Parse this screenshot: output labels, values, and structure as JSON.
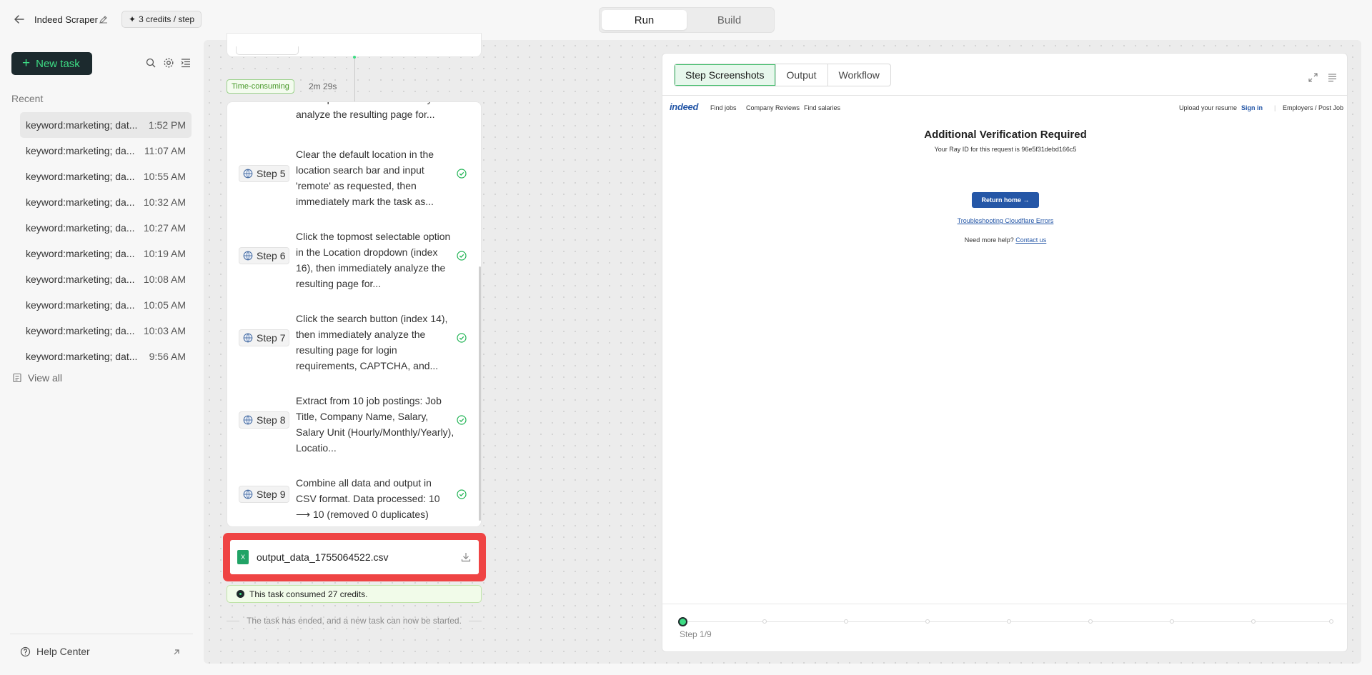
{
  "header": {
    "app_title": "Indeed Scraper",
    "credits_per_step": "3 credits / step",
    "mode_run": "Run",
    "mode_build": "Build"
  },
  "sidebar": {
    "new_task": "New task",
    "recent_heading": "Recent",
    "recent": [
      {
        "name": "keyword:marketing; dat...",
        "time": "1:52 PM"
      },
      {
        "name": "keyword:marketing; da...",
        "time": "11:07 AM"
      },
      {
        "name": "keyword:marketing; da...",
        "time": "10:55 AM"
      },
      {
        "name": "keyword:marketing; da...",
        "time": "10:32 AM"
      },
      {
        "name": "keyword:marketing; da...",
        "time": "10:27 AM"
      },
      {
        "name": "keyword:marketing; da...",
        "time": "10:19 AM"
      },
      {
        "name": "keyword:marketing; da...",
        "time": "10:08 AM"
      },
      {
        "name": "keyword:marketing; da...",
        "time": "10:05 AM"
      },
      {
        "name": "keyword:marketing; da...",
        "time": "10:03 AM"
      },
      {
        "name": "keyword:marketing; dat...",
        "time": "9:56 AM"
      }
    ],
    "view_all": "View all",
    "help_center": "Help Center"
  },
  "workflow": {
    "badge": "Time-consuming",
    "duration": "2m 29s",
    "partial_text": "the dropdown and immediately analyze the resulting page for...",
    "steps": [
      {
        "label": "Step 5",
        "text": "Clear the default location in the location search bar and input 'remote' as requested, then immediately mark the task as..."
      },
      {
        "label": "Step 6",
        "text": "Click the topmost selectable option in the Location dropdown (index 16), then immediately analyze the resulting page for..."
      },
      {
        "label": "Step 7",
        "text": "Click the search button (index 14), then immediately analyze the resulting page for login requirements, CAPTCHA, and..."
      },
      {
        "label": "Step 8",
        "text": "Extract from 10 job postings: Job Title, Company Name, Salary, Salary Unit (Hourly/Monthly/Yearly), Locatio..."
      },
      {
        "label": "Step 9",
        "text": "Combine all data and output in CSV format. Data processed: 10 ⟶ 10 (removed 0 duplicates)"
      }
    ],
    "file_icon": "X",
    "file_name": "output_data_1755064522.csv",
    "credits_msg": "This task consumed 27 credits.",
    "ended_msg": "The task has ended, and a new task can now be started."
  },
  "panel": {
    "tabs": [
      "Step Screenshots",
      "Output",
      "Workflow"
    ],
    "active_tab": "Step Screenshots",
    "timeline_label": "Step 1/9",
    "timeline_current": 1,
    "timeline_total": 9
  },
  "screenshot": {
    "logo": "indeed",
    "nav": [
      "Find jobs",
      "Company Reviews",
      "Find salaries"
    ],
    "upload": "Upload your resume",
    "sign_in": "Sign in",
    "employers": "Employers / Post Job",
    "title": "Additional Verification Required",
    "ray": "Your Ray ID for this request is 96e5f31debd166c5",
    "button": "Return home →",
    "link": "Troubleshooting Cloudflare Errors",
    "help": "Need more help?",
    "contact": "Contact us"
  },
  "colors": {
    "accent_green": "#3ddc84",
    "new_task_bg": "#1c2a2e",
    "highlight_red": "#ef4444",
    "indeed_blue": "#2557a7"
  }
}
